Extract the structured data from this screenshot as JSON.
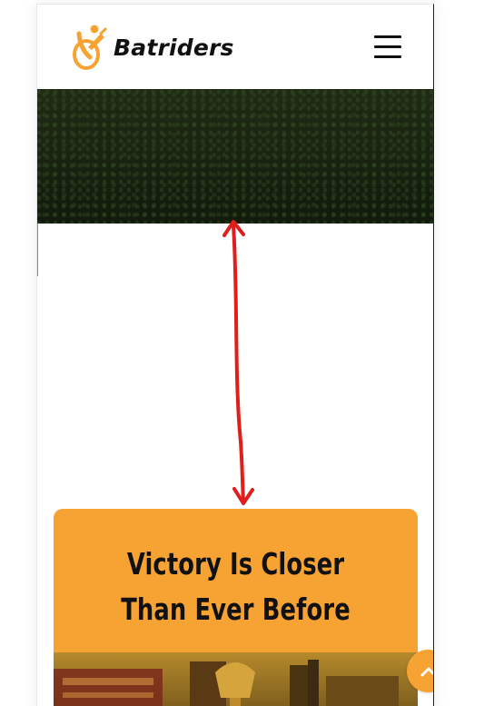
{
  "brand": {
    "name": "Batriders",
    "icon": "cricket-bat-ball-logo-icon",
    "accent_color": "#f6a333"
  },
  "header": {
    "menu_icon": "hamburger-menu-icon"
  },
  "hero": {
    "background": "dark-green-grass"
  },
  "cta": {
    "title_line1": "Victory Is Closer",
    "title_line2": "Than Ever Before",
    "background_color": "#f6a333"
  },
  "controls": {
    "scroll_top_icon": "chevron-up-icon"
  },
  "annotation": {
    "type": "double-headed-arrow",
    "color": "#e11d1d"
  }
}
